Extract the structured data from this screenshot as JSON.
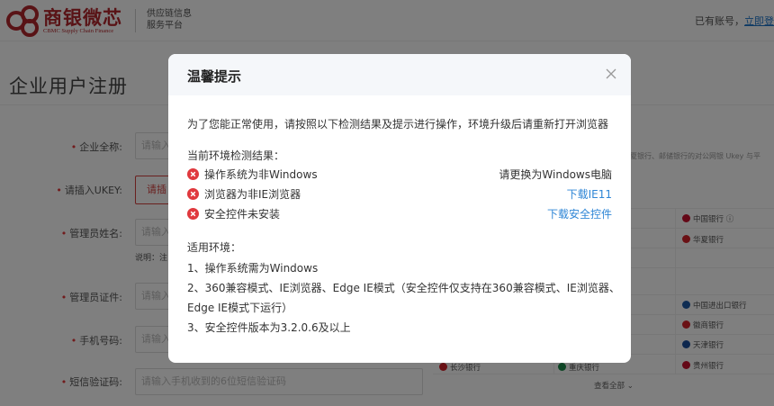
{
  "header": {
    "brand_name": "商银微芯",
    "brand_en": "CBMC Supply Chain Finance",
    "platform_line1": "供应链信息",
    "platform_line2": "服务平台",
    "login_prompt": "已有账号，",
    "login_link": "立即登"
  },
  "page": {
    "title": "企业用户注册"
  },
  "form": {
    "company_name_label": "企业全称:",
    "company_name_placeholder": "请输入",
    "ukey_label": "请插入UKEY:",
    "ukey_button": "请插",
    "admin_name_label": "管理员姓名:",
    "admin_name_placeholder": "请输入",
    "note_text": "说明：注",
    "admin_id_label": "管理员证件:",
    "admin_id_placeholder": "请输入",
    "phone_label": "手机号码:",
    "phone_placeholder": "请输入",
    "sms_label": "短信验证码:",
    "sms_placeholder": "请输入手机收到的6位短信验证码",
    "right_note": "夏银行、邮储银行的对公网银 Ukey 与平"
  },
  "banks": {
    "items": [
      {
        "name": "中国银行",
        "color": "#c8102e"
      },
      {
        "name": "华夏银行",
        "color": "#d4232b"
      },
      {
        "name": "中国进出口银行",
        "color": "#1f5aa6"
      },
      {
        "name": "徽商银行",
        "color": "#d4232b"
      },
      {
        "name": "天津银行",
        "color": "#1a4e9c"
      },
      {
        "name": "贵州银行",
        "color": "#c8102e"
      },
      {
        "name": "长沙银行",
        "color": "#d4232b"
      },
      {
        "name": "重庆银行",
        "color": "#1a8a4a"
      }
    ],
    "view_all": "查看全部 ⌄"
  },
  "modal": {
    "title": "温馨提示",
    "intro": "为了您能正常使用，请按照以下检测结果及提示进行操作，环境升级后请重新打开浏览器",
    "check_heading": "当前环境检测结果：",
    "checks": [
      {
        "text": "操作系统为非Windows",
        "action": "请更换为Windows电脑"
      },
      {
        "text": "浏览器为非IE浏览器",
        "action": "下载IE11"
      },
      {
        "text": "安全控件未安装",
        "action": "下载安全控件"
      }
    ],
    "env_heading": "适用环境：",
    "env_lines": [
      "1、操作系统需为Windows",
      "2、360兼容模式、IE浏览器、Edge IE模式（安全控件仅支持在360兼容模式、IE浏览器、",
      "Edge IE模式下运行）",
      "3、安全控件版本为3.2.0.6及以上"
    ]
  },
  "colors": {
    "brand_red": "#b3262c",
    "error_red": "#e0393e",
    "link_blue": "#2f86d6",
    "overlay": "rgba(0,0,0,0.5)"
  },
  "icons": {
    "logo": "cbmc-logo-icon",
    "close": "close-icon",
    "error": "error-circle-icon"
  }
}
